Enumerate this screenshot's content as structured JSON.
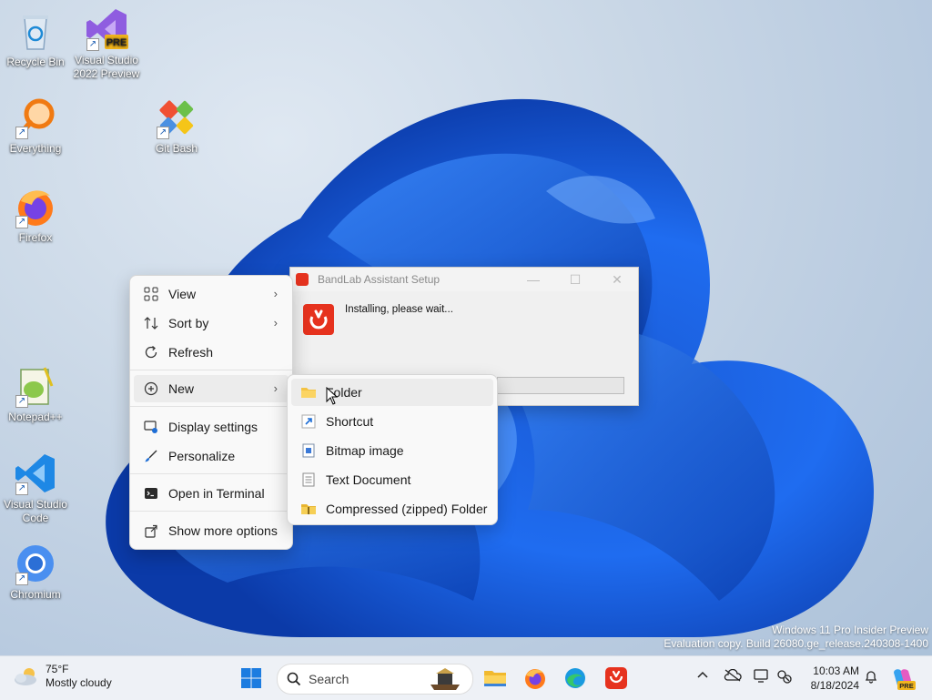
{
  "desktop": {
    "icons": [
      {
        "label": "Recycle Bin"
      },
      {
        "label": "Visual Studio 2022 Preview",
        "badge": "PRE"
      },
      {
        "label": "Everything"
      },
      {
        "label": "Git Bash"
      },
      {
        "label": "Firefox"
      },
      {
        "label": "Notepad++"
      },
      {
        "label": "Visual Studio Code"
      },
      {
        "label": "Chromium"
      }
    ]
  },
  "setup_window": {
    "title": "BandLab Assistant Setup",
    "message": "Installing, please wait...",
    "minimize": "—",
    "maximize": "☐",
    "close": "✕"
  },
  "context_menu": {
    "items": [
      {
        "label": "View",
        "icon": "grid-icon",
        "submenu": true
      },
      {
        "label": "Sort by",
        "icon": "sort-icon",
        "submenu": true
      },
      {
        "label": "Refresh",
        "icon": "refresh-icon"
      },
      {
        "label": "New",
        "icon": "plus-circle-icon",
        "submenu": true
      },
      {
        "label": "Display settings",
        "icon": "display-icon"
      },
      {
        "label": "Personalize",
        "icon": "brush-icon"
      },
      {
        "label": "Open in Terminal",
        "icon": "terminal-icon"
      },
      {
        "label": "Show more options",
        "icon": "share-icon"
      }
    ]
  },
  "new_submenu": {
    "items": [
      {
        "label": "Folder",
        "icon": "folder-icon"
      },
      {
        "label": "Shortcut",
        "icon": "shortcut-icon"
      },
      {
        "label": "Bitmap image",
        "icon": "bitmap-icon"
      },
      {
        "label": "Text Document",
        "icon": "text-doc-icon"
      },
      {
        "label": "Compressed (zipped) Folder",
        "icon": "zip-folder-icon"
      }
    ]
  },
  "watermark": {
    "line1": "Windows 11 Pro Insider Preview",
    "line2": "Evaluation copy. Build 26080.ge_release.240308-1400"
  },
  "taskbar": {
    "weather_temp": "75°F",
    "weather_desc": "Mostly cloudy",
    "search_placeholder": "Search",
    "time": "10:03 AM",
    "date": "8/18/2024",
    "copilot_badge": "PRE"
  },
  "colors": {
    "accent": "#0067c0",
    "bandlab_red": "#e6321e",
    "menu_bg": "#f9f9f9",
    "taskbar_bg": "#eef1f6"
  }
}
